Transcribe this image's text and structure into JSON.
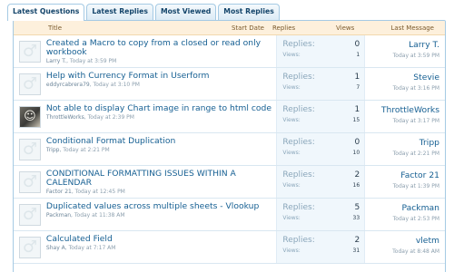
{
  "tabs": [
    {
      "label": "Latest Questions",
      "active": true
    },
    {
      "label": "Latest Replies",
      "active": false
    },
    {
      "label": "Most Viewed",
      "active": false
    },
    {
      "label": "Most Replies",
      "active": false
    }
  ],
  "table": {
    "headers": {
      "title": "Title",
      "start_date": "Start Date",
      "replies": "Replies",
      "views": "Views",
      "last_message": "Last Message"
    },
    "stats_labels": {
      "replies": "Replies:",
      "views": "Views:"
    },
    "rows": [
      {
        "title": "Created a Macro to copy from a closed or read only workbook",
        "author": "Larry T.",
        "date": "Today at 3:59 PM",
        "replies": "0",
        "views": "1",
        "last_user": "Larry T.",
        "last_date": "Today at 3:59 PM",
        "avatar": "generic"
      },
      {
        "title": "Help with Currency Format in Userform",
        "author": "eddyrcabrera79",
        "date": "Today at 3:10 PM",
        "replies": "1",
        "views": "7",
        "last_user": "Stevie",
        "last_date": "Today at 3:16 PM",
        "avatar": "generic"
      },
      {
        "title": "Not able to display Chart image in range to html code",
        "author": "ThrottleWorks",
        "date": "Today at 2:39 PM",
        "replies": "1",
        "views": "15",
        "last_user": "ThrottleWorks",
        "last_date": "Today at 3:17 PM",
        "avatar": "photo"
      },
      {
        "title": "Conditional Format Duplication",
        "author": "Tripp",
        "date": "Today at 2:21 PM",
        "replies": "0",
        "views": "10",
        "last_user": "Tripp",
        "last_date": "Today at 2:21 PM",
        "avatar": "generic"
      },
      {
        "title": "CONDITIONAL FORMATTING ISSUES WITHIN A CALENDAR",
        "author": "Factor 21",
        "date": "Today at 12:45 PM",
        "replies": "2",
        "views": "16",
        "last_user": "Factor 21",
        "last_date": "Today at 1:39 PM",
        "avatar": "generic"
      },
      {
        "title": "Duplicated values across multiple sheets - Vlookup",
        "author": "Packman",
        "date": "Today at 11:38 AM",
        "replies": "5",
        "views": "33",
        "last_user": "Packman",
        "last_date": "Today at 2:53 PM",
        "avatar": "generic"
      },
      {
        "title": "Calculated Field",
        "author": "Shay A",
        "date": "Today at 7:17 AM",
        "replies": "2",
        "views": "31",
        "last_user": "vletm",
        "last_date": "Today at 8:48 AM",
        "avatar": "generic"
      }
    ]
  },
  "icons": {
    "generic_avatar": "male-symbol-icon",
    "photo_avatar": "user-photo-icon"
  },
  "colors": {
    "link": "#176093",
    "header_bg": "#fdf0dc",
    "stats_bg": "#f0f7fc",
    "tab_border": "#a5cae4"
  }
}
